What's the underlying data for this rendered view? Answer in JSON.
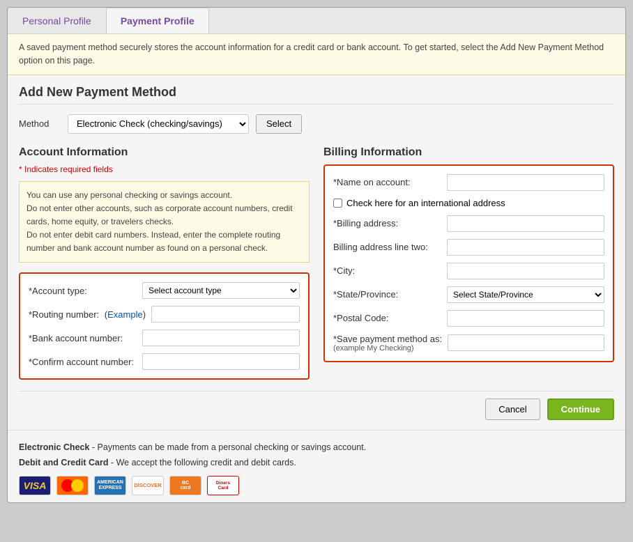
{
  "tabs": {
    "personal_label": "Personal Profile",
    "payment_label": "Payment Profile"
  },
  "info_banner": "A saved payment method securely stores the account information for a credit card or bank account. To get started, select the Add New Payment Method option on this page.",
  "add_payment": {
    "title": "Add New Payment Method",
    "method_label": "Method",
    "method_select_value": "Electronic Check (checking/savings)",
    "select_button": "Select"
  },
  "account_info": {
    "title": "Account Information",
    "required_note": "* Indicates required fields",
    "info_lines": [
      "You can use any personal checking or savings account.",
      "Do not enter other accounts, such as corporate account numbers, credit cards, home equity, or travelers checks.",
      "Do not enter debit card numbers. Instead, enter the complete routing number and bank account number as found on a personal check."
    ],
    "account_type_label": "*Account type:",
    "account_type_placeholder": "Select account type",
    "routing_label": "*Routing number:",
    "routing_example": "Example",
    "bank_account_label": "*Bank account number:",
    "confirm_account_label": "*Confirm account number:"
  },
  "billing_info": {
    "title": "Billing Information",
    "name_label": "*Name on account:",
    "international_label": "Check here for an international address",
    "billing_address_label": "*Billing address:",
    "billing_address2_label": "Billing address line two:",
    "city_label": "*City:",
    "state_label": "*State/Province:",
    "state_placeholder": "Select State/Province",
    "postal_label": "*Postal Code:",
    "save_method_label": "*Save payment method as:",
    "save_method_sub": "(example My Checking)"
  },
  "buttons": {
    "cancel": "Cancel",
    "continue": "Continue"
  },
  "footer": {
    "electronic_check_label": "Electronic Check",
    "electronic_check_text": " - Payments can be made from a personal checking or savings  account.",
    "debit_label": "Debit and Credit Card",
    "debit_text": " - We accept the following credit and debit cards."
  },
  "cards": [
    {
      "name": "visa",
      "label": "VISA"
    },
    {
      "name": "mastercard",
      "label": ""
    },
    {
      "name": "amex",
      "label": "AMERICAN EXPRESS"
    },
    {
      "name": "discover",
      "label": "DISCOVER"
    },
    {
      "name": "bcard",
      "label": "BCcard"
    },
    {
      "name": "diners",
      "label": "DinersCard"
    }
  ]
}
